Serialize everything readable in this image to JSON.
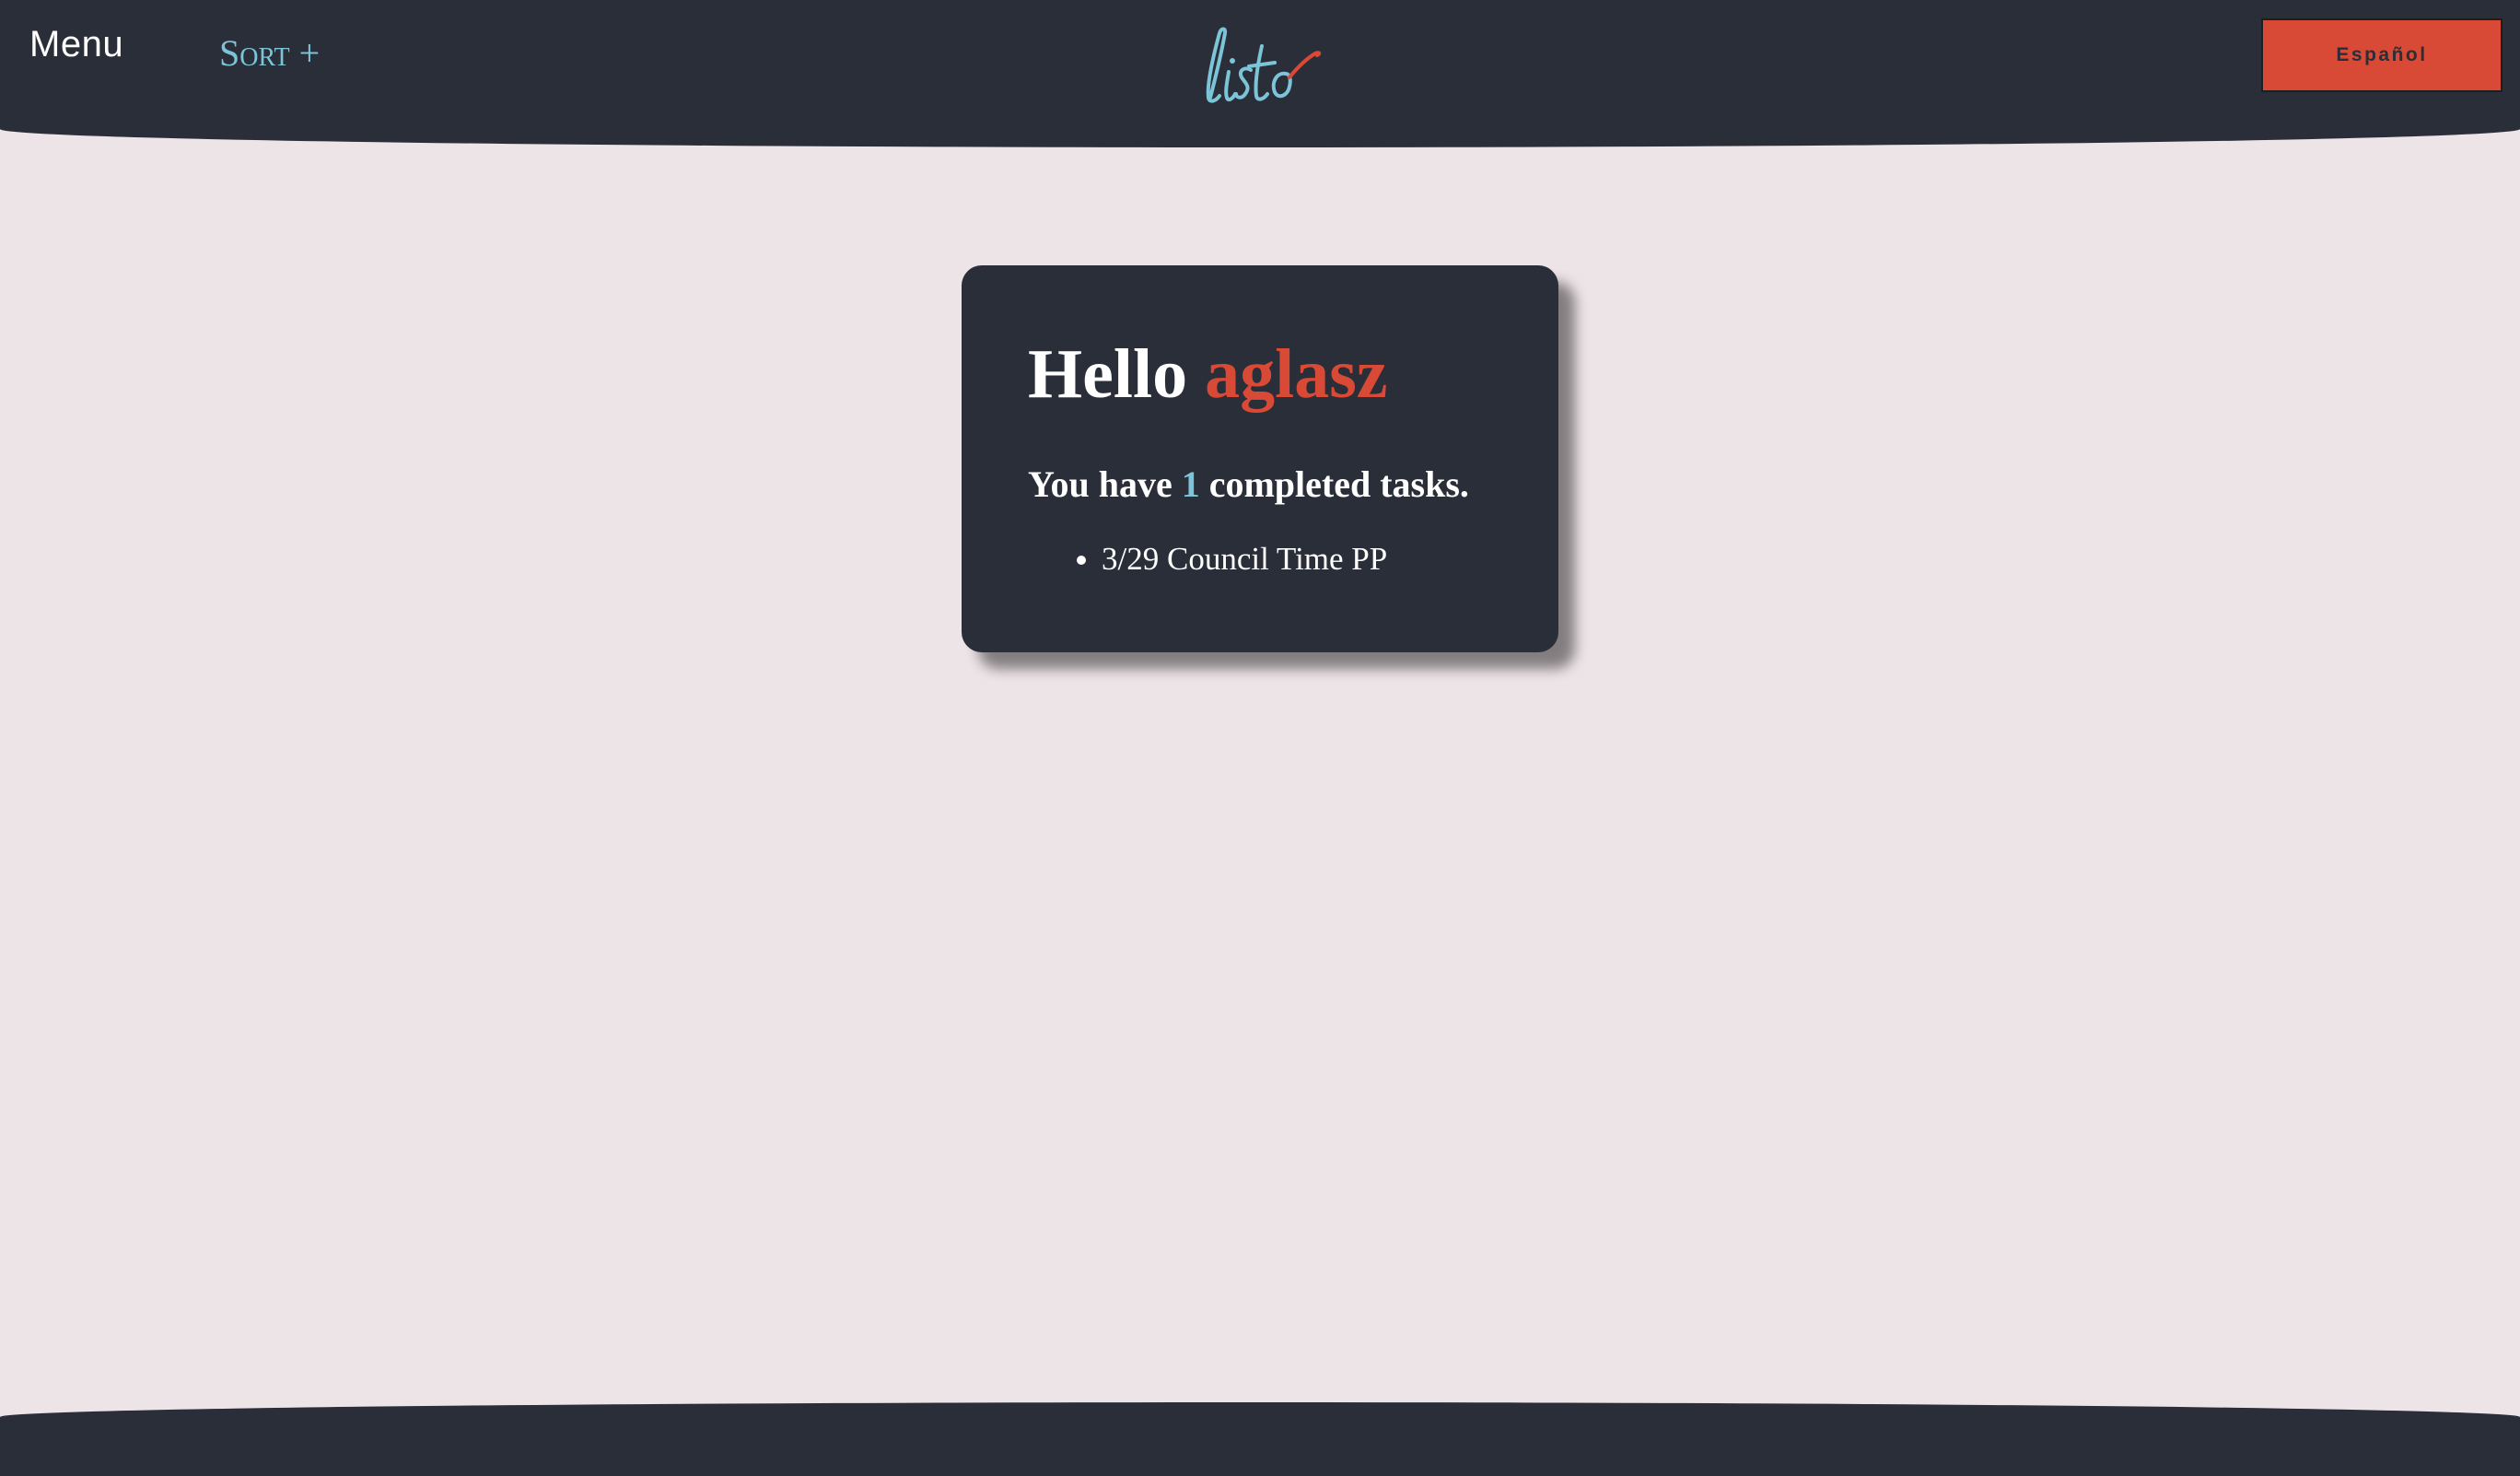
{
  "header": {
    "menu_label": "Menu",
    "sort_label": "Sort +",
    "logo_text": "listo",
    "language_button_label": "Español"
  },
  "card": {
    "greeting_prefix": "Hello",
    "username": "aglasz",
    "summary_prefix": "You have",
    "completed_count": "1",
    "summary_suffix": "completed tasks.",
    "tasks": [
      "3/29 Council Time PP"
    ]
  },
  "colors": {
    "dark": "#2a2e38",
    "background": "#ede4e7",
    "accent_red": "#d84a35",
    "accent_teal": "#7cc4d8"
  }
}
